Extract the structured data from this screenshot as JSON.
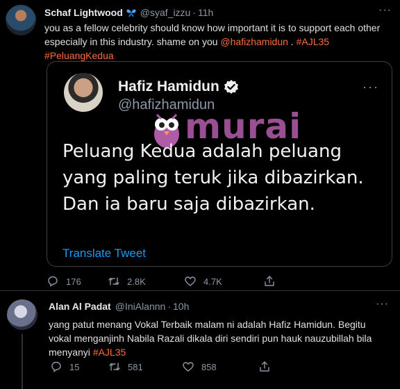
{
  "tweet1": {
    "name": "Schaf Lightwood",
    "badge_icon": "butterfly-emoji-icon",
    "handle": "@syaf_izzu",
    "dot": "·",
    "time": "11h",
    "text_before": "you as a fellow celebrity should know how important it is to support each other especially in this industry. shame on you ",
    "mention": "@hafizhamidun",
    "text_mid": " . ",
    "tag1": "#AJL35",
    "tag2": "#PeluangKedua",
    "more": "···",
    "quote": {
      "name": "Hafiz Hamidun",
      "handle": "@hafizhamidun",
      "more": "···",
      "text": "Peluang Kedua adalah peluang yang paling teruk jika dibazirkan. Dan ia baru saja dibazirkan.",
      "translate": "Translate Tweet",
      "watermark": "murai"
    },
    "actions": {
      "replies": "176",
      "retweets": "2.8K",
      "likes": "4.7K"
    }
  },
  "tweet2": {
    "name": "Alan Al Padat",
    "handle": "@IniAlannn",
    "dot": "·",
    "time": "10h",
    "text": "yang patut menang Vokal Terbaik malam ni adalah Hafiz Hamidun. Begitu vokal menganjinh Nabila Razali dikala diri sendiri pun hauk nauzubillah bila menyanyi ",
    "tag": "#AJL35",
    "more": "···",
    "actions": {
      "replies": "15",
      "retweets": "581",
      "likes": "858"
    }
  },
  "colors": {
    "accent": "#1d9bf0",
    "hashtag": "#ff6b3d",
    "muted": "#8b98a5",
    "background": "#000000"
  }
}
